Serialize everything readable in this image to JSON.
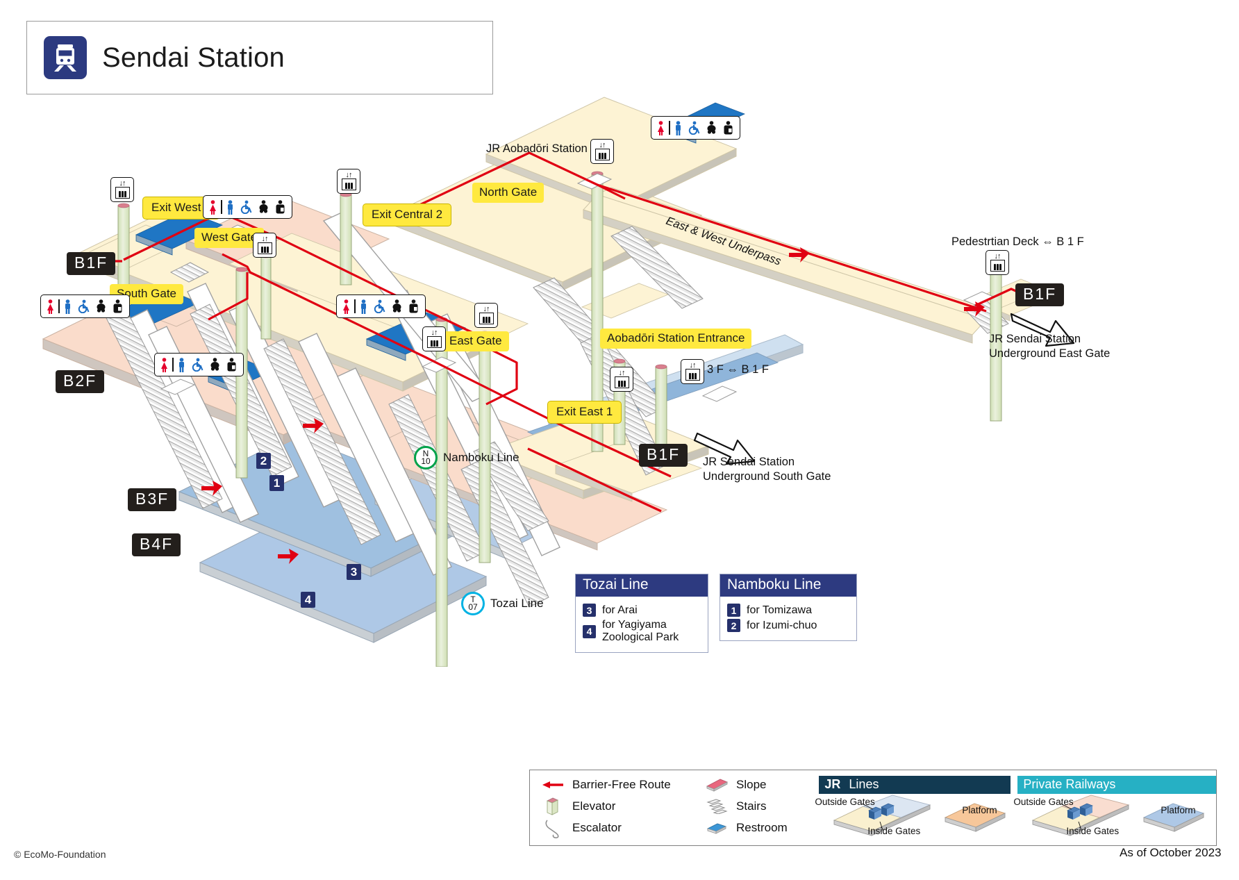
{
  "header": {
    "title": "Sendai Station",
    "icon": "train-icon",
    "icon_bg": "#2c3a80"
  },
  "floors": [
    {
      "id": "b1f-west",
      "label": "B1F"
    },
    {
      "id": "b2f",
      "label": "B2F"
    },
    {
      "id": "b3f",
      "label": "B3F"
    },
    {
      "id": "b4f",
      "label": "B4F"
    },
    {
      "id": "b1f-east",
      "label": "B1F"
    },
    {
      "id": "b1f-south",
      "label": "B1F"
    }
  ],
  "gates": [
    {
      "id": "west-gate",
      "label": "West Gate"
    },
    {
      "id": "south-gate",
      "label": "South Gate"
    },
    {
      "id": "north-gate",
      "label": "North Gate"
    },
    {
      "id": "east-gate",
      "label": "East Gate"
    }
  ],
  "exits": [
    {
      "id": "exit-west-1",
      "label": "Exit West 1"
    },
    {
      "id": "exit-central-2",
      "label": "Exit Central 2"
    },
    {
      "id": "exit-east-1",
      "label": "Exit East 1"
    }
  ],
  "callouts": [
    {
      "id": "aobadori-station-entrance",
      "label": "Aobadōri Station Entrance"
    }
  ],
  "plain_labels": {
    "jr_aobadori_station": "JR Aobadōri Station",
    "east_west_underpass": "East & West Underpass",
    "pedestrian_deck": "Pedestrtian Deck ⇔ B 1 F",
    "three_f_to_b1f": "3 F ⇔ B 1 F",
    "jr_underground_east_gate_line1": "JR Sendai Station",
    "jr_underground_east_gate_line2": "Underground East Gate",
    "jr_underground_south_gate_line1": "JR Sendai Station",
    "jr_underground_south_gate_line2": "Underground South Gate"
  },
  "platform_numbers": [
    "1",
    "2",
    "3",
    "4"
  ],
  "station_markers": [
    {
      "id": "namboku-marker",
      "code_letter": "N",
      "code_number": "10",
      "name": "Namboku Line",
      "color": "#00a24a"
    },
    {
      "id": "tozai-marker",
      "code_letter": "T",
      "code_number": "07",
      "name": "Tozai Line",
      "color": "#00b2e3"
    }
  ],
  "line_boxes": [
    {
      "id": "tozai-line-box",
      "title": "Tozai Line",
      "rows": [
        {
          "num": "3",
          "text": "for Arai"
        },
        {
          "num": "4",
          "text": "for Yagiyama Zoological Park"
        }
      ]
    },
    {
      "id": "namboku-line-box",
      "title": "Namboku Line",
      "rows": [
        {
          "num": "1",
          "text": "for Tomizawa"
        },
        {
          "num": "2",
          "text": "for Izumi-chuo"
        }
      ]
    }
  ],
  "legend": {
    "col1": [
      {
        "icon": "barrier-free-arrow-icon",
        "label": "Barrier-Free Route"
      },
      {
        "icon": "elevator-icon",
        "label": "Elevator"
      },
      {
        "icon": "escalator-icon",
        "label": "Escalator"
      }
    ],
    "col2": [
      {
        "icon": "slope-icon",
        "label": "Slope"
      },
      {
        "icon": "stairs-icon",
        "label": "Stairs"
      },
      {
        "icon": "restroom-icon",
        "label": "Restroom"
      }
    ],
    "rail_groups": [
      {
        "id": "jr-lines",
        "badge": "JR",
        "title": "Lines",
        "header_color": "#123a52",
        "outside_gates": "Outside Gates",
        "inside_gates": "Inside Gates",
        "platform": "Platform",
        "concourse_outside_color": "#faf0cf",
        "concourse_inside_color": "#dce6f2",
        "platform_color": "#f7c79a"
      },
      {
        "id": "private-railways",
        "badge": "",
        "title": "Private Railways",
        "header_color": "#26b0c4",
        "outside_gates": "Outside Gates",
        "inside_gates": "Inside Gates",
        "platform": "Platform",
        "concourse_outside_color": "#faf0cf",
        "concourse_inside_color": "#f9ddd0",
        "platform_color": "#aec8e6"
      }
    ]
  },
  "footer": {
    "copyright": "© EcoMo-Foundation",
    "as_of": "As of October 2023"
  },
  "colors": {
    "barrier_free_route": "#e00012",
    "concourse_cream": "#fdf3d4",
    "concourse_pink": "#fadccb",
    "platform_blue": "#aec8e6",
    "platform_lightblue": "#cfe0f0",
    "restroom_blue": "#1f76c4",
    "elevator_shaft": "#dfeacb",
    "structure_gray": "#d6d6d6",
    "floor_badge": "#231f1c",
    "gate_yellow": "#ffe93f"
  }
}
